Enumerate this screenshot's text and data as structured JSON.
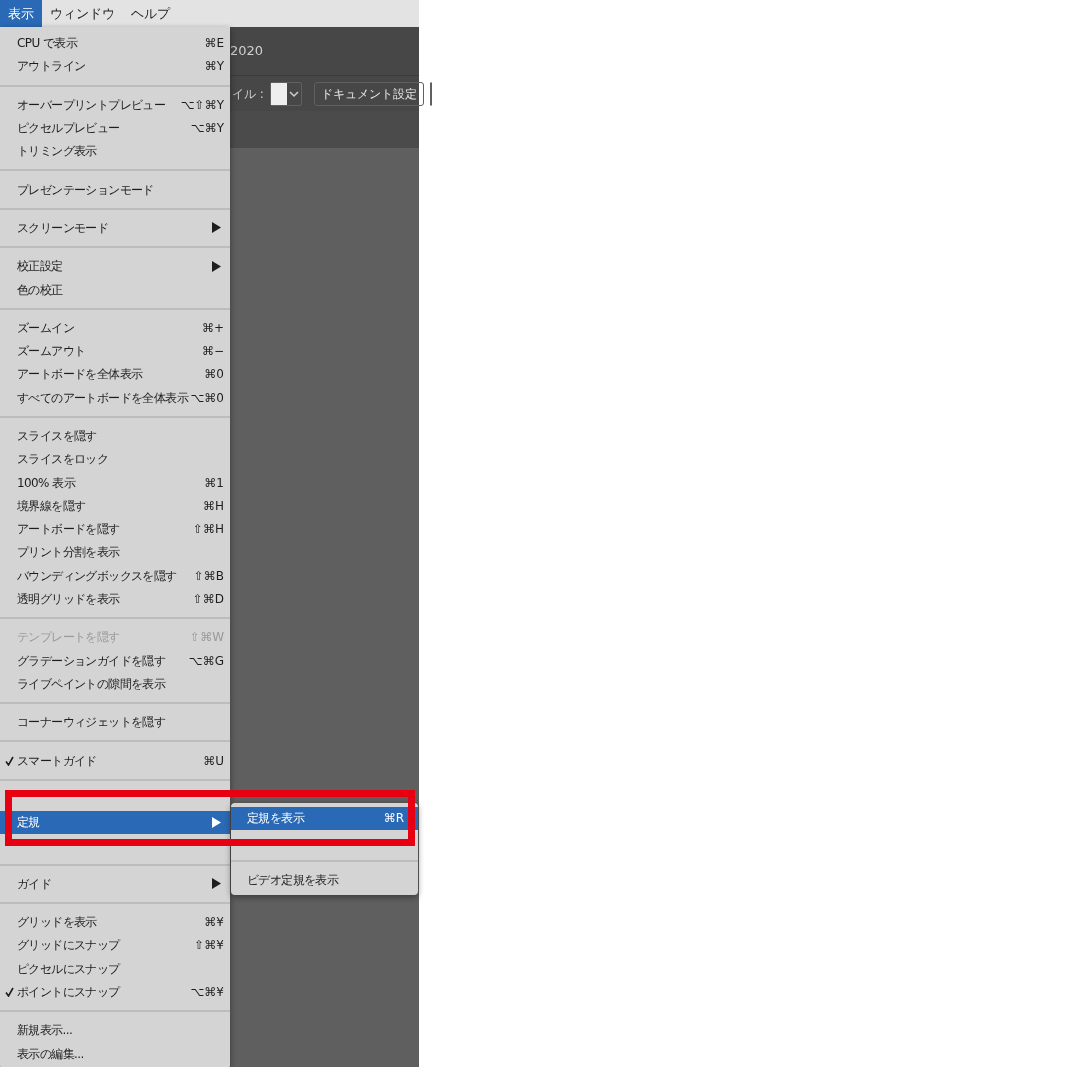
{
  "menubar": [
    {
      "label": "表示",
      "selected": true
    },
    {
      "label": "ウィンドウ",
      "selected": false
    },
    {
      "label": "ヘルプ",
      "selected": false
    }
  ],
  "app": {
    "title": "2020",
    "toolbar": {
      "style_label": "イル :",
      "document_button": "ドキュメント設定"
    }
  },
  "menu": [
    [
      {
        "kind": "item",
        "label": "CPU で表示",
        "shortcut": "⌘E",
        "checked": false,
        "disabled": false,
        "submenu": false,
        "selected": false
      },
      {
        "kind": "item",
        "label": "アウトライン",
        "shortcut": "⌘Y",
        "checked": false,
        "disabled": false,
        "submenu": false,
        "selected": false
      }
    ],
    [
      {
        "kind": "item",
        "label": "オーバープリントプレビュー",
        "shortcut": "⌥⇧⌘Y",
        "checked": false,
        "disabled": false,
        "submenu": false,
        "selected": false
      },
      {
        "kind": "item",
        "label": "ピクセルプレビュー",
        "shortcut": "⌥⌘Y",
        "checked": false,
        "disabled": false,
        "submenu": false,
        "selected": false
      },
      {
        "kind": "item",
        "label": "トリミング表示",
        "checked": false,
        "disabled": false,
        "submenu": false,
        "selected": false
      }
    ],
    [
      {
        "kind": "item",
        "label": "プレゼンテーションモード",
        "checked": false,
        "disabled": false,
        "submenu": false,
        "selected": false
      }
    ],
    [
      {
        "kind": "item",
        "label": "スクリーンモード",
        "checked": false,
        "disabled": false,
        "submenu": true,
        "selected": false
      }
    ],
    [
      {
        "kind": "item",
        "label": "校正設定",
        "checked": false,
        "disabled": false,
        "submenu": true,
        "selected": false
      },
      {
        "kind": "item",
        "label": "色の校正",
        "checked": false,
        "disabled": false,
        "submenu": false,
        "selected": false
      }
    ],
    [
      {
        "kind": "item",
        "label": "ズームイン",
        "shortcut": "⌘+",
        "checked": false,
        "disabled": false,
        "submenu": false,
        "selected": false
      },
      {
        "kind": "item",
        "label": "ズームアウト",
        "shortcut": "⌘−",
        "checked": false,
        "disabled": false,
        "submenu": false,
        "selected": false
      },
      {
        "kind": "item",
        "label": "アートボードを全体表示",
        "shortcut": "⌘0",
        "checked": false,
        "disabled": false,
        "submenu": false,
        "selected": false
      },
      {
        "kind": "item",
        "label": "すべてのアートボードを全体表示",
        "shortcut": "⌥⌘0",
        "checked": false,
        "disabled": false,
        "submenu": false,
        "selected": false
      }
    ],
    [
      {
        "kind": "item",
        "label": "スライスを隠す",
        "checked": false,
        "disabled": false,
        "submenu": false,
        "selected": false
      },
      {
        "kind": "item",
        "label": "スライスをロック",
        "checked": false,
        "disabled": false,
        "submenu": false,
        "selected": false
      },
      {
        "kind": "item",
        "label": "100% 表示",
        "shortcut": "⌘1",
        "checked": false,
        "disabled": false,
        "submenu": false,
        "selected": false
      },
      {
        "kind": "item",
        "label": "境界線を隠す",
        "shortcut": "⌘H",
        "checked": false,
        "disabled": false,
        "submenu": false,
        "selected": false
      },
      {
        "kind": "item",
        "label": "アートボードを隠す",
        "shortcut": "⇧⌘H",
        "checked": false,
        "disabled": false,
        "submenu": false,
        "selected": false
      },
      {
        "kind": "item",
        "label": "プリント分割を表示",
        "checked": false,
        "disabled": false,
        "submenu": false,
        "selected": false
      },
      {
        "kind": "item",
        "label": "バウンディングボックスを隠す",
        "shortcut": "⇧⌘B",
        "checked": false,
        "disabled": false,
        "submenu": false,
        "selected": false
      },
      {
        "kind": "item",
        "label": "透明グリッドを表示",
        "shortcut": "⇧⌘D",
        "checked": false,
        "disabled": false,
        "submenu": false,
        "selected": false
      }
    ],
    [
      {
        "kind": "item",
        "label": "テンプレートを隠す",
        "shortcut": "⇧⌘W",
        "checked": false,
        "disabled": true,
        "submenu": false,
        "selected": false
      },
      {
        "kind": "item",
        "label": "グラデーションガイドを隠す",
        "shortcut": "⌥⌘G",
        "checked": false,
        "disabled": false,
        "submenu": false,
        "selected": false
      },
      {
        "kind": "item",
        "label": "ライブペイントの隙間を表示",
        "checked": false,
        "disabled": false,
        "submenu": false,
        "selected": false
      }
    ],
    [
      {
        "kind": "item",
        "label": "コーナーウィジェットを隠す",
        "checked": false,
        "disabled": false,
        "submenu": false,
        "selected": false
      }
    ],
    [
      {
        "kind": "item",
        "label": "スマートガイド",
        "shortcut": "⌘U",
        "checked": true,
        "disabled": false,
        "submenu": false,
        "selected": false
      }
    ],
    [
      {
        "kind": "covered"
      },
      {
        "kind": "item",
        "label": "定規",
        "checked": false,
        "disabled": false,
        "submenu": true,
        "selected": true
      },
      {
        "kind": "covered"
      }
    ],
    [
      {
        "kind": "item",
        "label": "ガイド",
        "checked": false,
        "disabled": false,
        "submenu": true,
        "selected": false
      }
    ],
    [
      {
        "kind": "item",
        "label": "グリッドを表示",
        "shortcut": "⌘¥",
        "checked": false,
        "disabled": false,
        "submenu": false,
        "selected": false
      },
      {
        "kind": "item",
        "label": "グリッドにスナップ",
        "shortcut": "⇧⌘¥",
        "checked": false,
        "disabled": false,
        "submenu": false,
        "selected": false
      },
      {
        "kind": "item",
        "label": "ピクセルにスナップ",
        "checked": false,
        "disabled": false,
        "submenu": false,
        "selected": false
      },
      {
        "kind": "item",
        "label": "ポイントにスナップ",
        "shortcut": "⌥⌘¥",
        "checked": true,
        "disabled": false,
        "submenu": false,
        "selected": false
      }
    ],
    [
      {
        "kind": "item",
        "label": "新規表示...",
        "checked": false,
        "disabled": false,
        "submenu": false,
        "selected": false
      },
      {
        "kind": "item",
        "label": "表示の編集...",
        "checked": false,
        "disabled": false,
        "submenu": false,
        "selected": false
      }
    ]
  ],
  "submenu": [
    [
      {
        "kind": "item",
        "label": "定規を表示",
        "shortcut": "⌘R",
        "checked": false,
        "disabled": false,
        "submenu": false,
        "selected": true
      },
      {
        "kind": "covered"
      }
    ],
    [
      {
        "kind": "item",
        "label": "ビデオ定規を表示",
        "checked": false,
        "disabled": false,
        "submenu": false,
        "selected": false
      }
    ]
  ],
  "annotation": {
    "kind": "highlight-frame"
  }
}
